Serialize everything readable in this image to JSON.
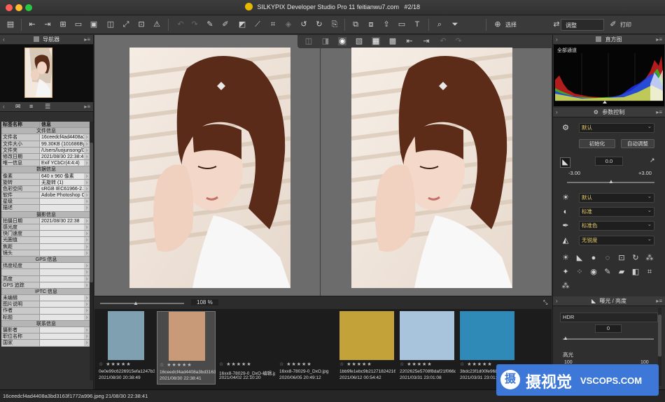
{
  "window": {
    "title": "SILKYPIX Developer Studio Pro 11 feitianwu7.com",
    "counter": "#2/18"
  },
  "toolbar": {
    "select_label": "选择",
    "mode_select": "调整",
    "print_label": "打印"
  },
  "navigator": {
    "title": "导航器"
  },
  "info_panel": {
    "header": {
      "tag": "标签名称",
      "info": "信息"
    },
    "rows": [
      {
        "type": "sec",
        "k": "文件信息"
      },
      {
        "k": "文件名",
        "v": "16ceedcf4ad4408a3"
      },
      {
        "k": "文件大小",
        "v": "99.30KB (101686By"
      },
      {
        "k": "文件夹",
        "v": "/Users/luojunsong/D"
      },
      {
        "k": "修改日期",
        "v": "2021/08/30 22:38:4"
      },
      {
        "k": "唯一信息",
        "v": "Exif YCbCr(4:4:4)"
      },
      {
        "type": "sec",
        "k": "数据信息"
      },
      {
        "k": "像素",
        "v": "640 x 960 像素"
      },
      {
        "k": "旋转",
        "v": "无旋转 (1)"
      },
      {
        "k": "色彩空间",
        "v": "sRGB IEC61966-2.1"
      },
      {
        "k": "软件",
        "v": "Adobe Photoshop C"
      },
      {
        "k": "星级",
        "v": ""
      },
      {
        "k": "描述",
        "v": ""
      },
      {
        "type": "sec",
        "k": "摄影信息"
      },
      {
        "k": "拍摄日期",
        "v": "2021/08/30 22:38"
      },
      {
        "k": "感光度",
        "v": ""
      },
      {
        "k": "快门速度",
        "v": ""
      },
      {
        "k": "光圈值",
        "v": ""
      },
      {
        "k": "焦距",
        "v": ""
      },
      {
        "k": "镜头",
        "v": ""
      },
      {
        "type": "sec",
        "k": "GPS 信息"
      },
      {
        "k": "纬度经度",
        "v": ""
      },
      {
        "k": "",
        "v": ""
      },
      {
        "k": "高度",
        "v": ""
      },
      {
        "k": "GPS 追踪",
        "v": ""
      },
      {
        "type": "sec",
        "k": "IPTC 信息"
      },
      {
        "k": "未编辑",
        "v": ""
      },
      {
        "k": "图片说明",
        "v": ""
      },
      {
        "k": "作者",
        "v": ""
      },
      {
        "k": "标题",
        "v": ""
      },
      {
        "type": "sec",
        "k": "联系信息"
      },
      {
        "k": "摄影者",
        "v": ""
      },
      {
        "k": "职位名称",
        "v": ""
      },
      {
        "k": "国家",
        "v": ""
      }
    ]
  },
  "zoom": {
    "value": "108 %"
  },
  "filmstrip": [
    {
      "name": "0e0e99c6226915efa1247b34",
      "date": "2021/08/30 20:38:49",
      "color": "#7fa0b0"
    },
    {
      "name": "16ceedcf4ad4408a3bd3163f",
      "date": "2021/08/30 22:38:41",
      "color": "#c89a78",
      "selected": true
    },
    {
      "name": "16xx8-78029-0_DxO-编辑.jpg",
      "date": "2021/04/02 22:10:20",
      "color": "#1c1c1c"
    },
    {
      "name": "16xx8-78029-0_DxO.jpg",
      "date": "2020/06/05 20:49:12",
      "color": "#1c1c1c"
    },
    {
      "name": "1bb9fe1ebc9b2127182421699",
      "date": "2021/06/12 00:54:42",
      "color": "#c4a23a"
    },
    {
      "name": "2202625e5708f8daf21f066d1",
      "date": "2021/03/31 23:01:08",
      "color": "#a8c4dc"
    },
    {
      "name": "3bdc23f1d00fe968",
      "date": "2021/03/31 23:01:08",
      "color": "#2f8ab8"
    }
  ],
  "right_panel": {
    "histogram": {
      "title": "直方图",
      "channel": "全部通道"
    },
    "params": {
      "title": "参数控制"
    },
    "taste": "默认",
    "init_button": "初始化",
    "auto_button": "自动调整",
    "exposure_value": "0.0",
    "exposure_min": "-3.00",
    "exposure_max": "+3.00",
    "white_balance": "默认",
    "tone": "标准",
    "color": "标准色",
    "sharpness": "无锐度",
    "exposure_section": "曝光 / 亮度",
    "hdr_label": "HDR",
    "hdr_value": "0",
    "highlight_label": "高光",
    "highlight_min": "100",
    "highlight_max": "100"
  },
  "status": {
    "text": "16ceedcf4ad4408a3bd3163f1772a996.jpeg 21/08/30 22:38:41"
  },
  "watermark": {
    "text": "摄视觉",
    "site": "VSCOPS.COM"
  }
}
